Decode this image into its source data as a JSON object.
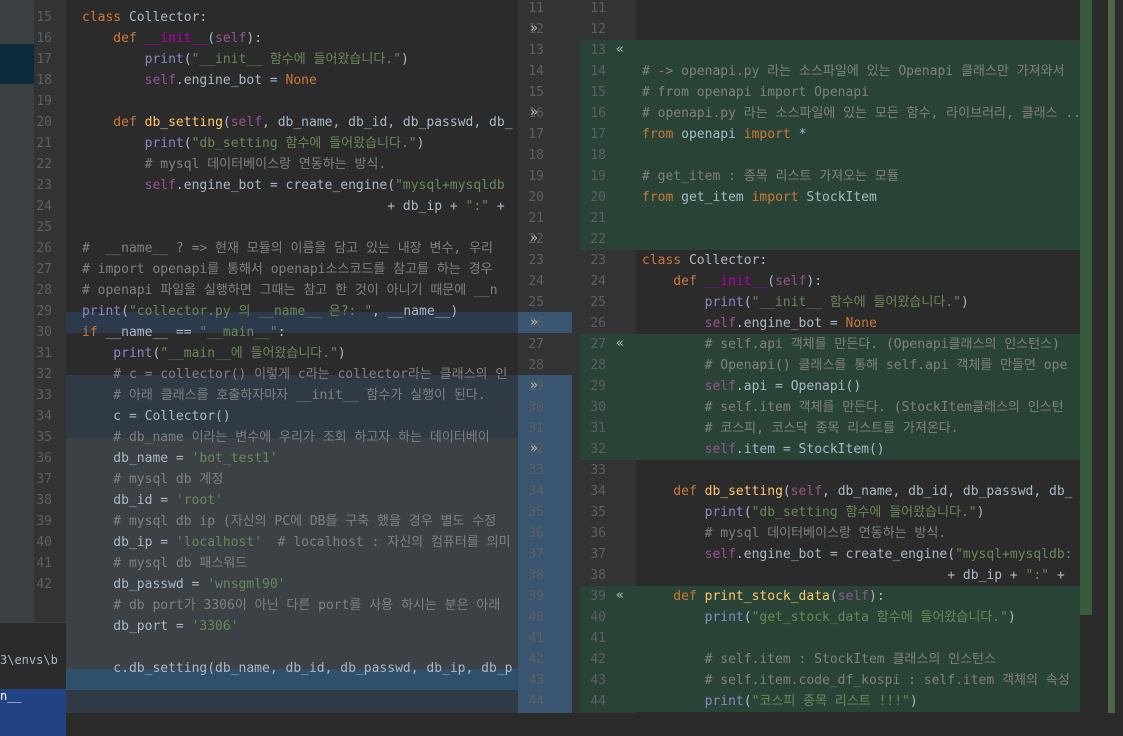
{
  "left_editor": {
    "lines": [
      {
        "n": "15",
        "code": [
          {
            "t": "class ",
            "c": "kw"
          },
          {
            "t": "Collector",
            "c": "id"
          },
          {
            "t": ":",
            "c": "id"
          }
        ]
      },
      {
        "n": "16",
        "code": [
          {
            "t": "    def ",
            "c": "kw"
          },
          {
            "t": "__init__",
            "c": "mg"
          },
          {
            "t": "(",
            "c": "id"
          },
          {
            "t": "self",
            "c": "sf"
          },
          {
            "t": "):",
            "c": "id"
          }
        ]
      },
      {
        "n": "17",
        "code": [
          {
            "t": "        print",
            "c": "bi"
          },
          {
            "t": "(",
            "c": "id"
          },
          {
            "t": "\"__init__ 함수에 들어왔습니다.\"",
            "c": "st"
          },
          {
            "t": ")",
            "c": "id"
          }
        ]
      },
      {
        "n": "18",
        "code": [
          {
            "t": "        self",
            "c": "sf"
          },
          {
            "t": ".engine_bot = ",
            "c": "id"
          },
          {
            "t": "None",
            "c": "kw"
          }
        ]
      },
      {
        "n": "19",
        "code": []
      },
      {
        "n": "20",
        "code": [
          {
            "t": "    def ",
            "c": "kw"
          },
          {
            "t": "db_setting",
            "c": "fn"
          },
          {
            "t": "(",
            "c": "id"
          },
          {
            "t": "self",
            "c": "sf"
          },
          {
            "t": ", db_name, db_id, db_passwd, db_",
            "c": "id"
          }
        ]
      },
      {
        "n": "21",
        "code": [
          {
            "t": "        print",
            "c": "bi"
          },
          {
            "t": "(",
            "c": "id"
          },
          {
            "t": "\"db_setting 함수에 들어왔습니다.\"",
            "c": "st"
          },
          {
            "t": ")",
            "c": "id"
          }
        ]
      },
      {
        "n": "22",
        "code": [
          {
            "t": "        # mysql 데이터베이스랑 연동하는 방식.",
            "c": "cm"
          }
        ]
      },
      {
        "n": "23",
        "code": [
          {
            "t": "        self",
            "c": "sf"
          },
          {
            "t": ".engine_bot = create_engine(",
            "c": "id"
          },
          {
            "t": "\"mysql+mysqldb",
            "c": "st"
          }
        ]
      },
      {
        "n": "24",
        "code": [
          {
            "t": "                                       + db_ip + ",
            "c": "id"
          },
          {
            "t": "\":\"",
            "c": "st"
          },
          {
            "t": " +",
            "c": "id"
          }
        ]
      },
      {
        "n": "25",
        "code": []
      },
      {
        "n": "26",
        "code": [
          {
            "t": "#  __name__ ? => 현재 모듈의 이름을 담고 있는 내장 변수, 우리",
            "c": "cm"
          }
        ]
      },
      {
        "n": "27",
        "code": [
          {
            "t": "# import openapi를 통해서 openapi소스코드를 참고를 하는 경우",
            "c": "cm"
          }
        ]
      },
      {
        "n": "28",
        "code": [
          {
            "t": "# openapi 파일을 실행하면 그때는 참고 한 것이 아니기 때문에 __n",
            "c": "cm"
          }
        ]
      },
      {
        "n": "29",
        "code": [
          {
            "t": "print",
            "c": "bi"
          },
          {
            "t": "(",
            "c": "id"
          },
          {
            "t": "\"collector.py 의 __name__ 은?: \"",
            "c": "st"
          },
          {
            "t": ", __name__)",
            "c": "id"
          }
        ]
      },
      {
        "n": "30",
        "code": [
          {
            "t": "if ",
            "c": "kw"
          },
          {
            "t": "__name__ == ",
            "c": "id"
          },
          {
            "t": "\"__main__\"",
            "c": "st"
          },
          {
            "t": ":",
            "c": "id"
          }
        ]
      },
      {
        "n": "31",
        "code": [
          {
            "t": "    print",
            "c": "bi"
          },
          {
            "t": "(",
            "c": "id"
          },
          {
            "t": "\"__main__에 들어왔습니다.\"",
            "c": "st"
          },
          {
            "t": ")",
            "c": "id"
          }
        ]
      },
      {
        "n": "32",
        "code": [
          {
            "t": "    # c = collector() 이렇게 c라는 collector라는 클래스의 인",
            "c": "cm"
          }
        ]
      },
      {
        "n": "33",
        "code": [
          {
            "t": "    # 아래 클래스를 호출하자마자 __init__ 함수가 실행이 된다.",
            "c": "cm"
          }
        ]
      },
      {
        "n": "34",
        "code": [
          {
            "t": "    c = Collector()",
            "c": "id"
          }
        ]
      },
      {
        "n": "35",
        "code": [
          {
            "t": "    # db_name 이라는 변수에 우리가 조회 하고자 하는 데이터베이",
            "c": "cm"
          }
        ]
      },
      {
        "n": "36",
        "code": [
          {
            "t": "    db_name = ",
            "c": "id"
          },
          {
            "t": "'bot_test1'",
            "c": "st"
          }
        ]
      },
      {
        "n": "37",
        "code": [
          {
            "t": "    # mysql db 계정",
            "c": "cm"
          }
        ]
      },
      {
        "n": "38",
        "code": [
          {
            "t": "    db_id = ",
            "c": "id"
          },
          {
            "t": "'root'",
            "c": "st"
          }
        ]
      },
      {
        "n": "39",
        "code": [
          {
            "t": "    # mysql db ip (자신의 PC에 DB를 구축 했을 경우 별도 수정",
            "c": "cm"
          }
        ]
      },
      {
        "n": "40",
        "code": [
          {
            "t": "    db_ip = ",
            "c": "id"
          },
          {
            "t": "'localhost'",
            "c": "st"
          },
          {
            "t": "  # localhost : 자신의 컴퓨터를 의미",
            "c": "cm"
          }
        ]
      },
      {
        "n": "41",
        "code": [
          {
            "t": "    # mysql db 패스워드",
            "c": "cm"
          }
        ]
      },
      {
        "n": "42",
        "code": [
          {
            "t": "    db_passwd = ",
            "c": "id"
          },
          {
            "t": "'wnsgml90'",
            "c": "st"
          }
        ]
      },
      {
        "n": "",
        "code": [
          {
            "t": "    # db port가 3306이 아닌 다른 port를 사용 하시는 분은 아래",
            "c": "cm"
          }
        ]
      },
      {
        "n": "",
        "code": [
          {
            "t": "    db_port = ",
            "c": "id"
          },
          {
            "t": "'3306'",
            "c": "st"
          }
        ]
      },
      {
        "n": "",
        "code": []
      },
      {
        "n": "",
        "code": [
          {
            "t": "    c.db_setting(db_name, db_id, db_passwd, db_ip, db_p",
            "c": "id"
          }
        ]
      }
    ]
  },
  "terminal": {
    "line1": "3\\envs\\b",
    "line2": "n__"
  },
  "diff_middle": {
    "left_numbers": [
      "11",
      "12",
      "13",
      "14",
      "15",
      "16",
      "17",
      "18",
      "19",
      "20",
      "21",
      "22",
      "23",
      "24",
      "25",
      "26",
      "27",
      "28",
      "29",
      "30",
      "31",
      "32",
      "33",
      "34",
      "35",
      "36",
      "37",
      "38",
      "39",
      "40",
      "41",
      "42",
      "43",
      "44"
    ],
    "chevron_right_rows": [
      1,
      5,
      11,
      15,
      18,
      21
    ],
    "chevron_left_rows": [
      2,
      16,
      28
    ]
  },
  "right_editor": {
    "numbers": [
      "11",
      "12",
      "13",
      "14",
      "15",
      "16",
      "17",
      "18",
      "19",
      "20",
      "21",
      "22",
      "23",
      "24",
      "25",
      "26",
      "27",
      "28",
      "29",
      "30",
      "31",
      "32",
      "33",
      "34",
      "35",
      "36",
      "37",
      "38",
      "39",
      "40",
      "41",
      "42",
      "43",
      "44"
    ],
    "lines": [
      [],
      [],
      [],
      [
        {
          "t": "# -> openapi.py 라는 소스파일에 있는 Openapi 클래스만 가져와서",
          "c": "cm"
        }
      ],
      [
        {
          "t": "# from openapi import Openapi",
          "c": "cm"
        }
      ],
      [
        {
          "t": "# openapi.py 라는 소스파일에 있는 모든 함수, 라이브러리, 클래스 ...",
          "c": "cm"
        }
      ],
      [
        {
          "t": "from ",
          "c": "kw"
        },
        {
          "t": "openapi ",
          "c": "id"
        },
        {
          "t": "import ",
          "c": "kw"
        },
        {
          "t": "*",
          "c": "id"
        }
      ],
      [],
      [
        {
          "t": "# get_item : 종목 리스트 가져오는 모듈",
          "c": "cm"
        }
      ],
      [
        {
          "t": "from ",
          "c": "kw"
        },
        {
          "t": "get_item ",
          "c": "id"
        },
        {
          "t": "import ",
          "c": "kw"
        },
        {
          "t": "StockItem",
          "c": "id"
        }
      ],
      [],
      [],
      [
        {
          "t": "class ",
          "c": "kw"
        },
        {
          "t": "Collector:",
          "c": "id"
        }
      ],
      [
        {
          "t": "    def ",
          "c": "kw"
        },
        {
          "t": "__init__",
          "c": "mg"
        },
        {
          "t": "(",
          "c": "id"
        },
        {
          "t": "self",
          "c": "sf"
        },
        {
          "t": "):",
          "c": "id"
        }
      ],
      [
        {
          "t": "        print",
          "c": "bi"
        },
        {
          "t": "(",
          "c": "id"
        },
        {
          "t": "\"__init__ 함수에 들어왔습니다.\"",
          "c": "st"
        },
        {
          "t": ")",
          "c": "id"
        }
      ],
      [
        {
          "t": "        self",
          "c": "sf"
        },
        {
          "t": ".engine_bot = ",
          "c": "id"
        },
        {
          "t": "None",
          "c": "kw"
        }
      ],
      [
        {
          "t": "        # self.api 객체를 만든다. (Openapi클래스의 인스턴스)",
          "c": "cm"
        }
      ],
      [
        {
          "t": "        # Openapi() 클래스를 통해 self.api 객체를 만들면 ope",
          "c": "cm"
        }
      ],
      [
        {
          "t": "        self",
          "c": "sf"
        },
        {
          "t": ".api = Openapi()",
          "c": "id"
        }
      ],
      [
        {
          "t": "        # self.item 객체를 만든다. (StockItem클래스의 인스턴",
          "c": "cm"
        }
      ],
      [
        {
          "t": "        # 코스피, 코스닥 종목 리스트를 가져온다.",
          "c": "cm"
        }
      ],
      [
        {
          "t": "        self",
          "c": "sf"
        },
        {
          "t": ".item = StockItem()",
          "c": "id"
        }
      ],
      [],
      [
        {
          "t": "    def ",
          "c": "kw"
        },
        {
          "t": "db_setting",
          "c": "fn"
        },
        {
          "t": "(",
          "c": "id"
        },
        {
          "t": "self",
          "c": "sf"
        },
        {
          "t": ", db_name, db_id, db_passwd, db_",
          "c": "id"
        }
      ],
      [
        {
          "t": "        print",
          "c": "bi"
        },
        {
          "t": "(",
          "c": "id"
        },
        {
          "t": "\"db_setting 함수에 들어왔습니다.\"",
          "c": "st"
        },
        {
          "t": ")",
          "c": "id"
        }
      ],
      [
        {
          "t": "        # mysql 데이터베이스랑 연동하는 방식.",
          "c": "cm"
        }
      ],
      [
        {
          "t": "        self",
          "c": "sf"
        },
        {
          "t": ".engine_bot = create_engine(",
          "c": "id"
        },
        {
          "t": "\"mysql+mysqldb:",
          "c": "st"
        }
      ],
      [
        {
          "t": "                                       + db_ip + ",
          "c": "id"
        },
        {
          "t": "\":\"",
          "c": "st"
        },
        {
          "t": " +",
          "c": "id"
        }
      ],
      [
        {
          "t": "    def ",
          "c": "kw"
        },
        {
          "t": "print_stock_data",
          "c": "fn"
        },
        {
          "t": "(",
          "c": "id"
        },
        {
          "t": "self",
          "c": "sf"
        },
        {
          "t": "):",
          "c": "id"
        }
      ],
      [
        {
          "t": "        print",
          "c": "bi"
        },
        {
          "t": "(",
          "c": "id"
        },
        {
          "t": "\"get_stock_data 함수에 들어왔습니다.\"",
          "c": "st"
        },
        {
          "t": ")",
          "c": "id"
        }
      ],
      [],
      [
        {
          "t": "        # self.item : StockItem 클래스의 인스턴스",
          "c": "cm"
        }
      ],
      [
        {
          "t": "        # self.item.code_df_kospi : self.item 객체의 속성",
          "c": "cm"
        }
      ],
      [
        {
          "t": "        print",
          "c": "bi"
        },
        {
          "t": "(",
          "c": "id"
        },
        {
          "t": "\"코스피 종목 리스트 !!!\"",
          "c": "st"
        },
        {
          "t": ")",
          "c": "id"
        }
      ]
    ]
  }
}
